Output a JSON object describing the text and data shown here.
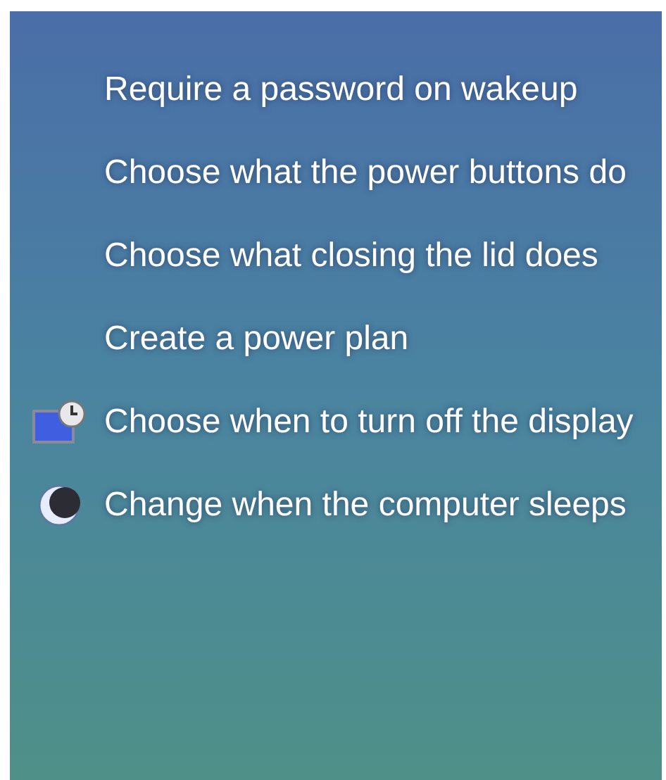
{
  "tasks": [
    {
      "label": "Require a password on wakeup",
      "kind": "link"
    },
    {
      "label": "Choose what the power buttons do",
      "kind": "link"
    },
    {
      "label": "Choose what closing the lid does",
      "kind": "link"
    },
    {
      "label": "Create a power plan",
      "kind": "link"
    },
    {
      "label": "Choose when to turn off the display",
      "kind": "display"
    },
    {
      "label": "Change when the computer sleeps",
      "kind": "sleep"
    }
  ]
}
